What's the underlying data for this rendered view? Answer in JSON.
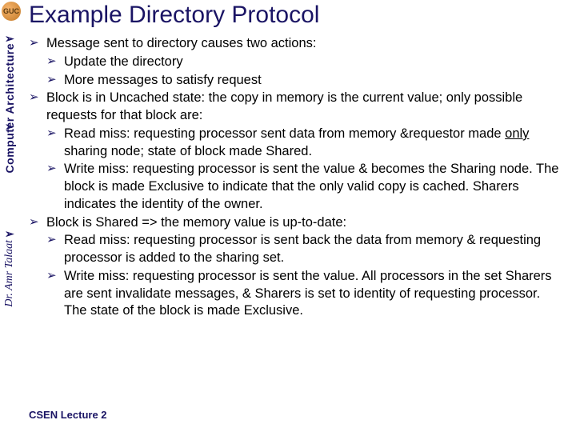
{
  "title": "Example Directory Protocol",
  "sidebar": {
    "logo_text": "GUC",
    "course": "Computer Architecture",
    "author": "Dr. Amr Talaat"
  },
  "bullets": {
    "b1": "Message sent to directory causes two actions:",
    "b1a": "Update the directory",
    "b1b": "More messages to satisfy request",
    "b2": "Block is in Uncached state: the copy in memory is the current value; only possible requests for that block are:",
    "b2a_pre": "Read miss: requesting processor sent data from memory &requestor made ",
    "b2a_u": "only",
    "b2a_post": " sharing node; state of block made Shared.",
    "b2b": "Write miss: requesting processor is sent the value & becomes the Sharing node. The block is made Exclusive to indicate that the only valid copy is cached. Sharers indicates the identity of the owner.",
    "b3": "Block is Shared => the memory value is up-to-date:",
    "b3a": "Read miss: requesting processor is sent back the data from memory & requesting processor is added to the sharing set.",
    "b3b": "Write miss: requesting processor is sent the value. All processors in the set Sharers are sent invalidate messages, & Sharers is set to identity of requesting processor. The state of the block is made Exclusive."
  },
  "footer": "CSEN Lecture  2"
}
